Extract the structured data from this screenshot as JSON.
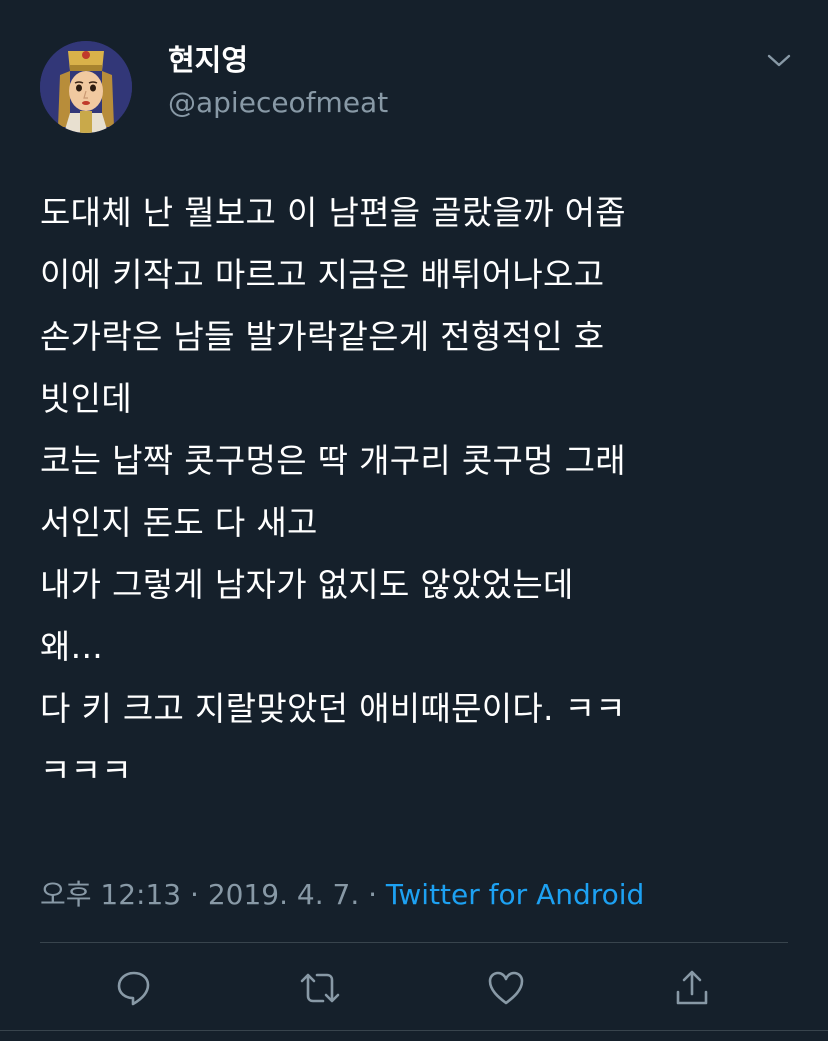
{
  "user": {
    "display_name": "현지영",
    "handle": "@apieceofmeat"
  },
  "tweet": {
    "lines": [
      "도대체 난 뭘보고 이 남편을 골랐을까 어좁",
      "이에 키작고 마르고 지금은 배튀어나오고",
      "손가락은 남들 발가락같은게 전형적인 호",
      "빗인데",
      "코는 납짝 콧구멍은 딱 개구리 콧구멍 그래",
      "서인지 돈도 다 새고",
      "내가 그렇게 남자가 없지도 않았었는데",
      "왜...",
      "다 키 크고 지랄맞았던 애비때문이다. ㅋㅋ",
      "ㅋㅋㅋ"
    ]
  },
  "meta": {
    "time": "오후 12:13",
    "separator1": " · ",
    "date": "2019. 4. 7.",
    "separator2": " · ",
    "source": "Twitter for Android"
  },
  "icons": {
    "more": "chevron-down-icon",
    "reply": "reply-icon",
    "retweet": "retweet-icon",
    "like": "heart-icon",
    "share": "share-icon"
  },
  "colors": {
    "background": "#15202b",
    "text": "#ffffff",
    "secondary": "#8899a6",
    "link": "#1da1f2",
    "divider": "#38444d"
  }
}
